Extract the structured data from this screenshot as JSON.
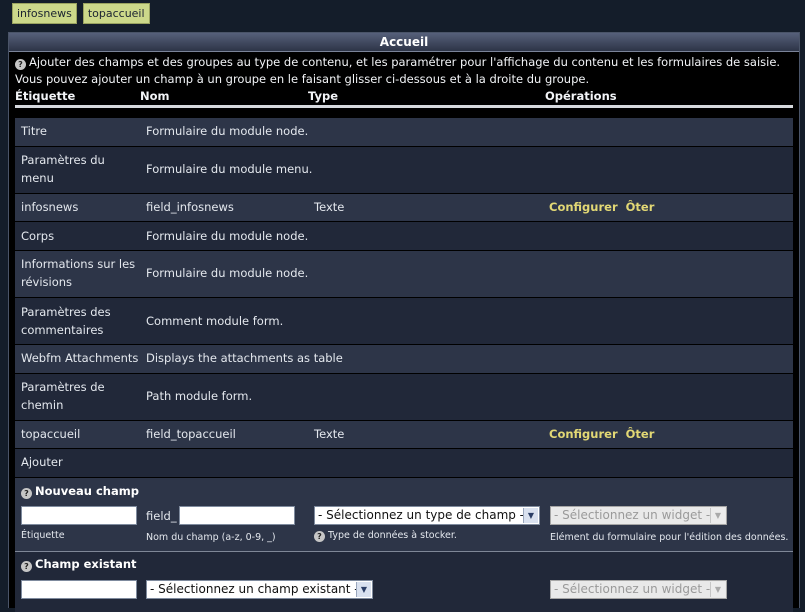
{
  "tabs": [
    "infosnews",
    "topaccueil"
  ],
  "panel": {
    "title": "Accueil",
    "help_line1": "Ajouter des champs et des groupes au type de contenu, et les paramétrer pour l'affichage du contenu et les formulaires de saisie.",
    "help_line2": "Vous pouvez ajouter un champ à un groupe en le faisant glisser ci-dessous et à la droite du groupe."
  },
  "columns": {
    "label": "Étiquette",
    "name": "Nom",
    "type": "Type",
    "operations": "Opérations"
  },
  "rows": [
    {
      "label": "Titre",
      "name": "Formulaire du module node.",
      "type": "",
      "op1": "",
      "op2": ""
    },
    {
      "label": "Paramètres du menu",
      "name": "Formulaire du module menu.",
      "type": "",
      "op1": "",
      "op2": ""
    },
    {
      "label": "infosnews",
      "name": "field_infosnews",
      "type": "Texte",
      "op1": "Configurer",
      "op2": "Ôter"
    },
    {
      "label": "Corps",
      "name": "Formulaire du module node.",
      "type": "",
      "op1": "",
      "op2": ""
    },
    {
      "label": "Informations sur les révisions",
      "name": "Formulaire du module node.",
      "type": "",
      "op1": "",
      "op2": ""
    },
    {
      "label": "Paramètres des commentaires",
      "name": "Comment module form.",
      "type": "",
      "op1": "",
      "op2": ""
    },
    {
      "label": "Webfm Attachments",
      "name": "Displays the attachments as table",
      "type": "",
      "op1": "",
      "op2": ""
    },
    {
      "label": "Paramètres de chemin",
      "name": "Path module form.",
      "type": "",
      "op1": "",
      "op2": ""
    },
    {
      "label": "topaccueil",
      "name": "field_topaccueil",
      "type": "Texte",
      "op1": "Configurer",
      "op2": "Ôter"
    }
  ],
  "add": {
    "title": "Ajouter",
    "new_field": {
      "title": "Nouveau champ",
      "label_help": "Étiquette",
      "prefix": "field_",
      "name_help": "Nom du champ (a-z, 0-9, _)",
      "type_select": "- Sélectionnez un type de champ -",
      "type_help": "Type de données à stocker.",
      "widget_select": "- Sélectionnez un widget -",
      "widget_help": "Elément du formulaire pour l'édition des données."
    },
    "existing_field": {
      "title": "Champ existant",
      "field_select": "- Sélectionnez un champ existant -",
      "widget_select": "- Sélectionnez un widget -"
    }
  }
}
